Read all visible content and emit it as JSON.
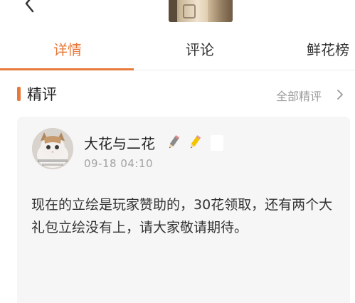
{
  "tabs": [
    {
      "label": "详情"
    },
    {
      "label": "评论"
    },
    {
      "label": "鲜花榜"
    }
  ],
  "section": {
    "title": "精评",
    "all_link": "全部精评"
  },
  "review": {
    "username": "大花与二花",
    "timestamp": "09-18 04:10",
    "content": "现在的立绘是玩家赞助的，30花领取，还有两个大礼包立绘没有上，请大家敬请期待。"
  },
  "colors": {
    "accent": "#e8793a",
    "muted_text": "#9a9a9a",
    "card_bg": "#f6f6f6"
  }
}
